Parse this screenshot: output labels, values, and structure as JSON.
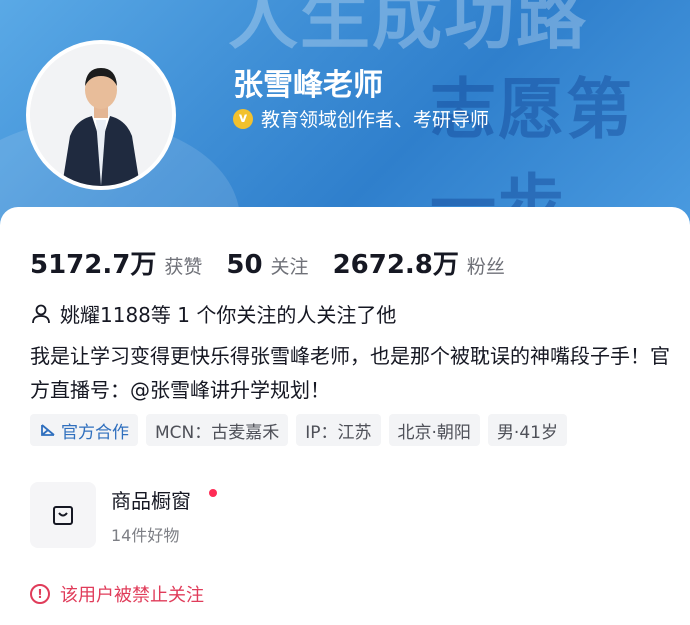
{
  "banner": {
    "bg_text_1": "人生成功路",
    "bg_text_2": "志愿第一步"
  },
  "profile": {
    "name": "张雪峰老师",
    "verify_icon_glyph": "v",
    "verification": "教育领域创作者、考研导师"
  },
  "stats": [
    {
      "value": "5172.7万",
      "label": "获赞"
    },
    {
      "value": "50",
      "label": "关注"
    },
    {
      "value": "2672.8万",
      "label": "粉丝"
    }
  ],
  "mutual_follow": "姚耀1188等 1 个你关注的人关注了他",
  "bio": "我是让学习变得更快乐得张雪峰老师，也是那个被耽误的神嘴段子手！官方直播号：@张雪峰讲升学规划！",
  "tags": {
    "official": "官方合作",
    "mcn": "MCN：古麦嘉禾",
    "ip": "IP：江苏",
    "location": "北京·朝阳",
    "gender_age": "男·41岁"
  },
  "shop": {
    "title": "商品橱窗",
    "subtitle": "14件好物"
  },
  "warning": {
    "icon_glyph": "!",
    "text": "该用户被禁止关注"
  },
  "colors": {
    "banner_blue": "#3f8fd6",
    "warning_red": "#e03c5a",
    "official_blue": "#2f6fbe",
    "dot_red": "#fe2c55"
  },
  "icons": [
    "person-icon",
    "verified-icon",
    "official-partner-icon",
    "shop-bag-icon",
    "warning-icon"
  ]
}
